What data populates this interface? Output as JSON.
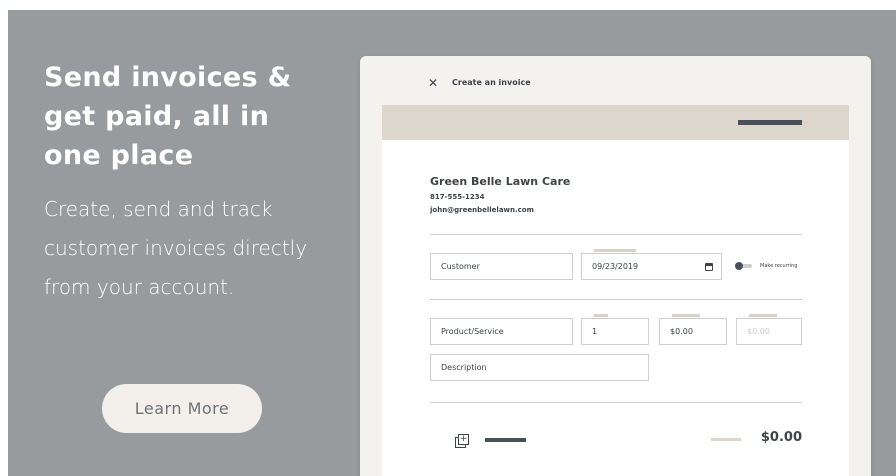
{
  "promo": {
    "headline": "Send invoices & get paid, all in one place",
    "subline": "Create, send and track customer invoices directly from your account.",
    "cta_label": "Learn More"
  },
  "window": {
    "title": "Create an invoice",
    "close_icon": "close-icon"
  },
  "business": {
    "name": "Green Belle Lawn Care",
    "phone": "817-555-1234",
    "email": "john@greenbellelawn.com"
  },
  "form": {
    "customer_placeholder": "Customer",
    "date_value": "09/23/2019",
    "recurring_label": "Make recurring",
    "product_placeholder": "Product/Service",
    "quantity_value": "1",
    "rate_value": "$0.00",
    "amount_value": "$0.00",
    "description_placeholder": "Description"
  },
  "summary": {
    "total": "$0.00",
    "add_icon": "add-line-icon"
  },
  "colors": {
    "backdrop": "#979b9e",
    "window_bg": "#f4f2ee",
    "toolbar": "#dcd6cd",
    "text_dark": "#3e4348",
    "cta_bg": "#f3f0eb"
  }
}
